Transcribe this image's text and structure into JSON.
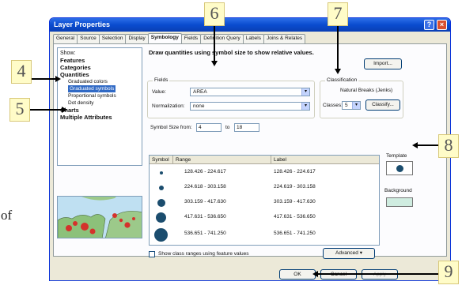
{
  "stray_text": "of",
  "window": {
    "title": "Layer Properties",
    "help_glyph": "?",
    "close_glyph": "×",
    "tabs": [
      "General",
      "Source",
      "Selection",
      "Display",
      "Symbology",
      "Fields",
      "Definition Query",
      "Labels",
      "Joins & Relates"
    ],
    "active_tab": "Symbology"
  },
  "show": {
    "header": "Show:",
    "items": [
      {
        "label": "Features",
        "level": "group"
      },
      {
        "label": "Categories",
        "level": "group"
      },
      {
        "label": "Quantities",
        "level": "group"
      },
      {
        "label": "Graduated colors",
        "level": "sub"
      },
      {
        "label": "Graduated symbols",
        "level": "sub",
        "selected": true
      },
      {
        "label": "Proportional symbols",
        "level": "sub"
      },
      {
        "label": "Dot density",
        "level": "sub"
      },
      {
        "label": "Charts",
        "level": "group"
      },
      {
        "label": "Multiple Attributes",
        "level": "group"
      }
    ]
  },
  "main": {
    "heading": "Draw quantities using symbol size to show relative values.",
    "import_label": "Import...",
    "fields_label": "Fields",
    "value_label": "Value:",
    "value_field": "AREA",
    "normalization_label": "Normalization:",
    "normalization_field": "none",
    "classification_label": "Classification",
    "classification_method": "Natural Breaks (Jenks)",
    "classes_label": "Classes:",
    "classes_value": "5",
    "classify_label": "Classify...",
    "symbol_size_from_label": "Symbol Size from:",
    "size_from": "4",
    "size_to_label": "to",
    "size_to": "18",
    "template_label": "Template",
    "background_label": "Background",
    "table_headers": [
      "Symbol",
      "Range",
      "Label"
    ],
    "rows": [
      {
        "range": "128.426 - 224.617",
        "label": "128.426 - 224.617"
      },
      {
        "range": "224.618 - 303.158",
        "label": "224.619 - 303.158"
      },
      {
        "range": "303.159 - 417.630",
        "label": "303.159 - 417.630"
      },
      {
        "range": "417.631 - 536.650",
        "label": "417.631 - 536.650"
      },
      {
        "range": "536.651 - 741.250",
        "label": "536.651 - 741.250"
      }
    ],
    "show_ranges_label": "Show class ranges using feature values",
    "advanced_label": "Advanced",
    "advanced_arrow": "▾",
    "dropdown_arrow": "▾"
  },
  "footer": {
    "ok_label": "OK",
    "cancel_label": "Cancel",
    "apply_label": "Apply"
  },
  "callouts": [
    "4",
    "5",
    "6",
    "7",
    "8",
    "9"
  ],
  "colors": {
    "titlebar": "#0a4ccf",
    "symbol": "#1b4d6e",
    "selection": "#316ac5",
    "callout_bg": "#fffcc8"
  }
}
